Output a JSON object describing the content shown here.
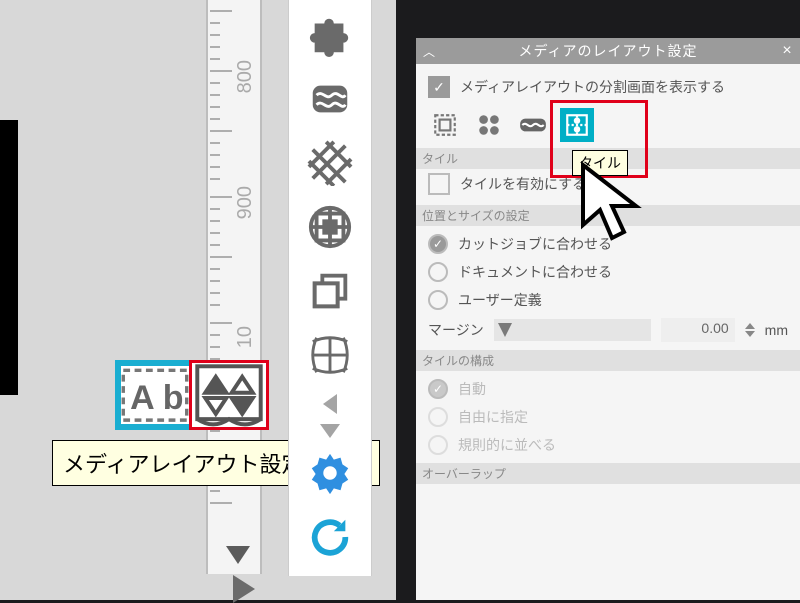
{
  "ruler": {
    "labels": [
      "800",
      "900",
      "10"
    ]
  },
  "palette": {
    "ab_text": "A b"
  },
  "tooltip_main": "メディアレイアウト設定パネル",
  "tooltip_tile": "タイル",
  "panel": {
    "title": "メディアのレイアウト設定",
    "show_split": "メディアレイアウトの分割画面を表示する",
    "section_tile": "タイル",
    "enable_tile": "タイルを有効にする",
    "section_sizepos": "位置とサイズの設定",
    "fit_cut": "カットジョブに合わせる",
    "fit_doc": "ドキュメントに合わせる",
    "fit_user": "ユーザー定義",
    "margin_label": "マージン",
    "margin_value": "0.00",
    "margin_unit": "mm",
    "section_tilecomp": "タイルの構成",
    "auto": "自動",
    "freeform": "自由に指定",
    "regular": "規則的に並べる",
    "section_overlap": "オーバーラップ"
  }
}
